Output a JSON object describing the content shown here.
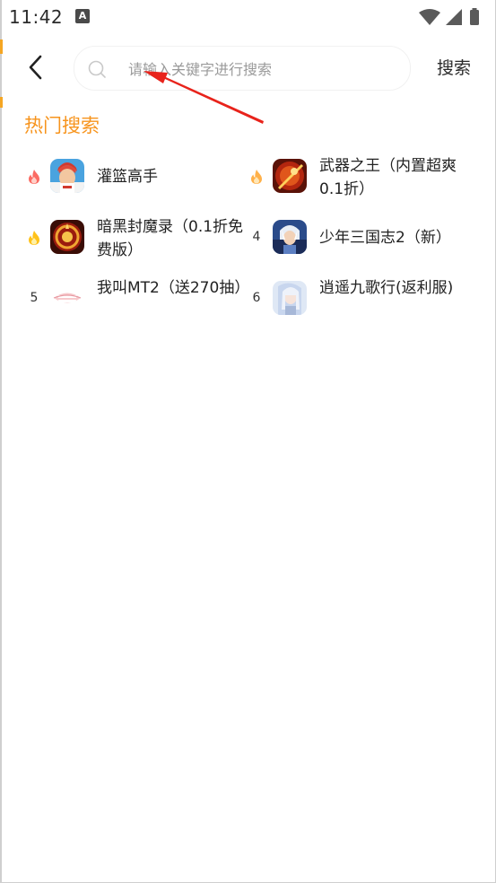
{
  "status_bar": {
    "time": "11:42",
    "badge": "A"
  },
  "search": {
    "placeholder": "请输入关键字进行搜索",
    "value": "",
    "button_label": "搜索"
  },
  "hot": {
    "title": "热门搜索",
    "items": [
      {
        "rank": "1",
        "rank_icon": "flame-red-icon",
        "name": "灌篮高手",
        "thumb": "slam-dunk-thumb"
      },
      {
        "rank": "2",
        "rank_icon": "flame-orange-icon",
        "name": "武器之王（内置超爽0.1折）",
        "thumb": "weapon-king-thumb"
      },
      {
        "rank": "3",
        "rank_icon": "flame-yellow-icon",
        "name": "暗黑封魔录（0.1折免费版）",
        "thumb": "dark-seal-thumb"
      },
      {
        "rank": "4",
        "name": "少年三国志2（新）",
        "thumb": "three-kingdoms-thumb"
      },
      {
        "rank": "5",
        "name": "我叫MT2（送270抽）",
        "thumb": "mt2-thumb"
      },
      {
        "rank": "6",
        "name": "逍遥九歌行(返利服)",
        "thumb": "nine-songs-thumb"
      }
    ]
  },
  "colors": {
    "accent": "#f7941d",
    "annotation_arrow": "#e8231b"
  }
}
